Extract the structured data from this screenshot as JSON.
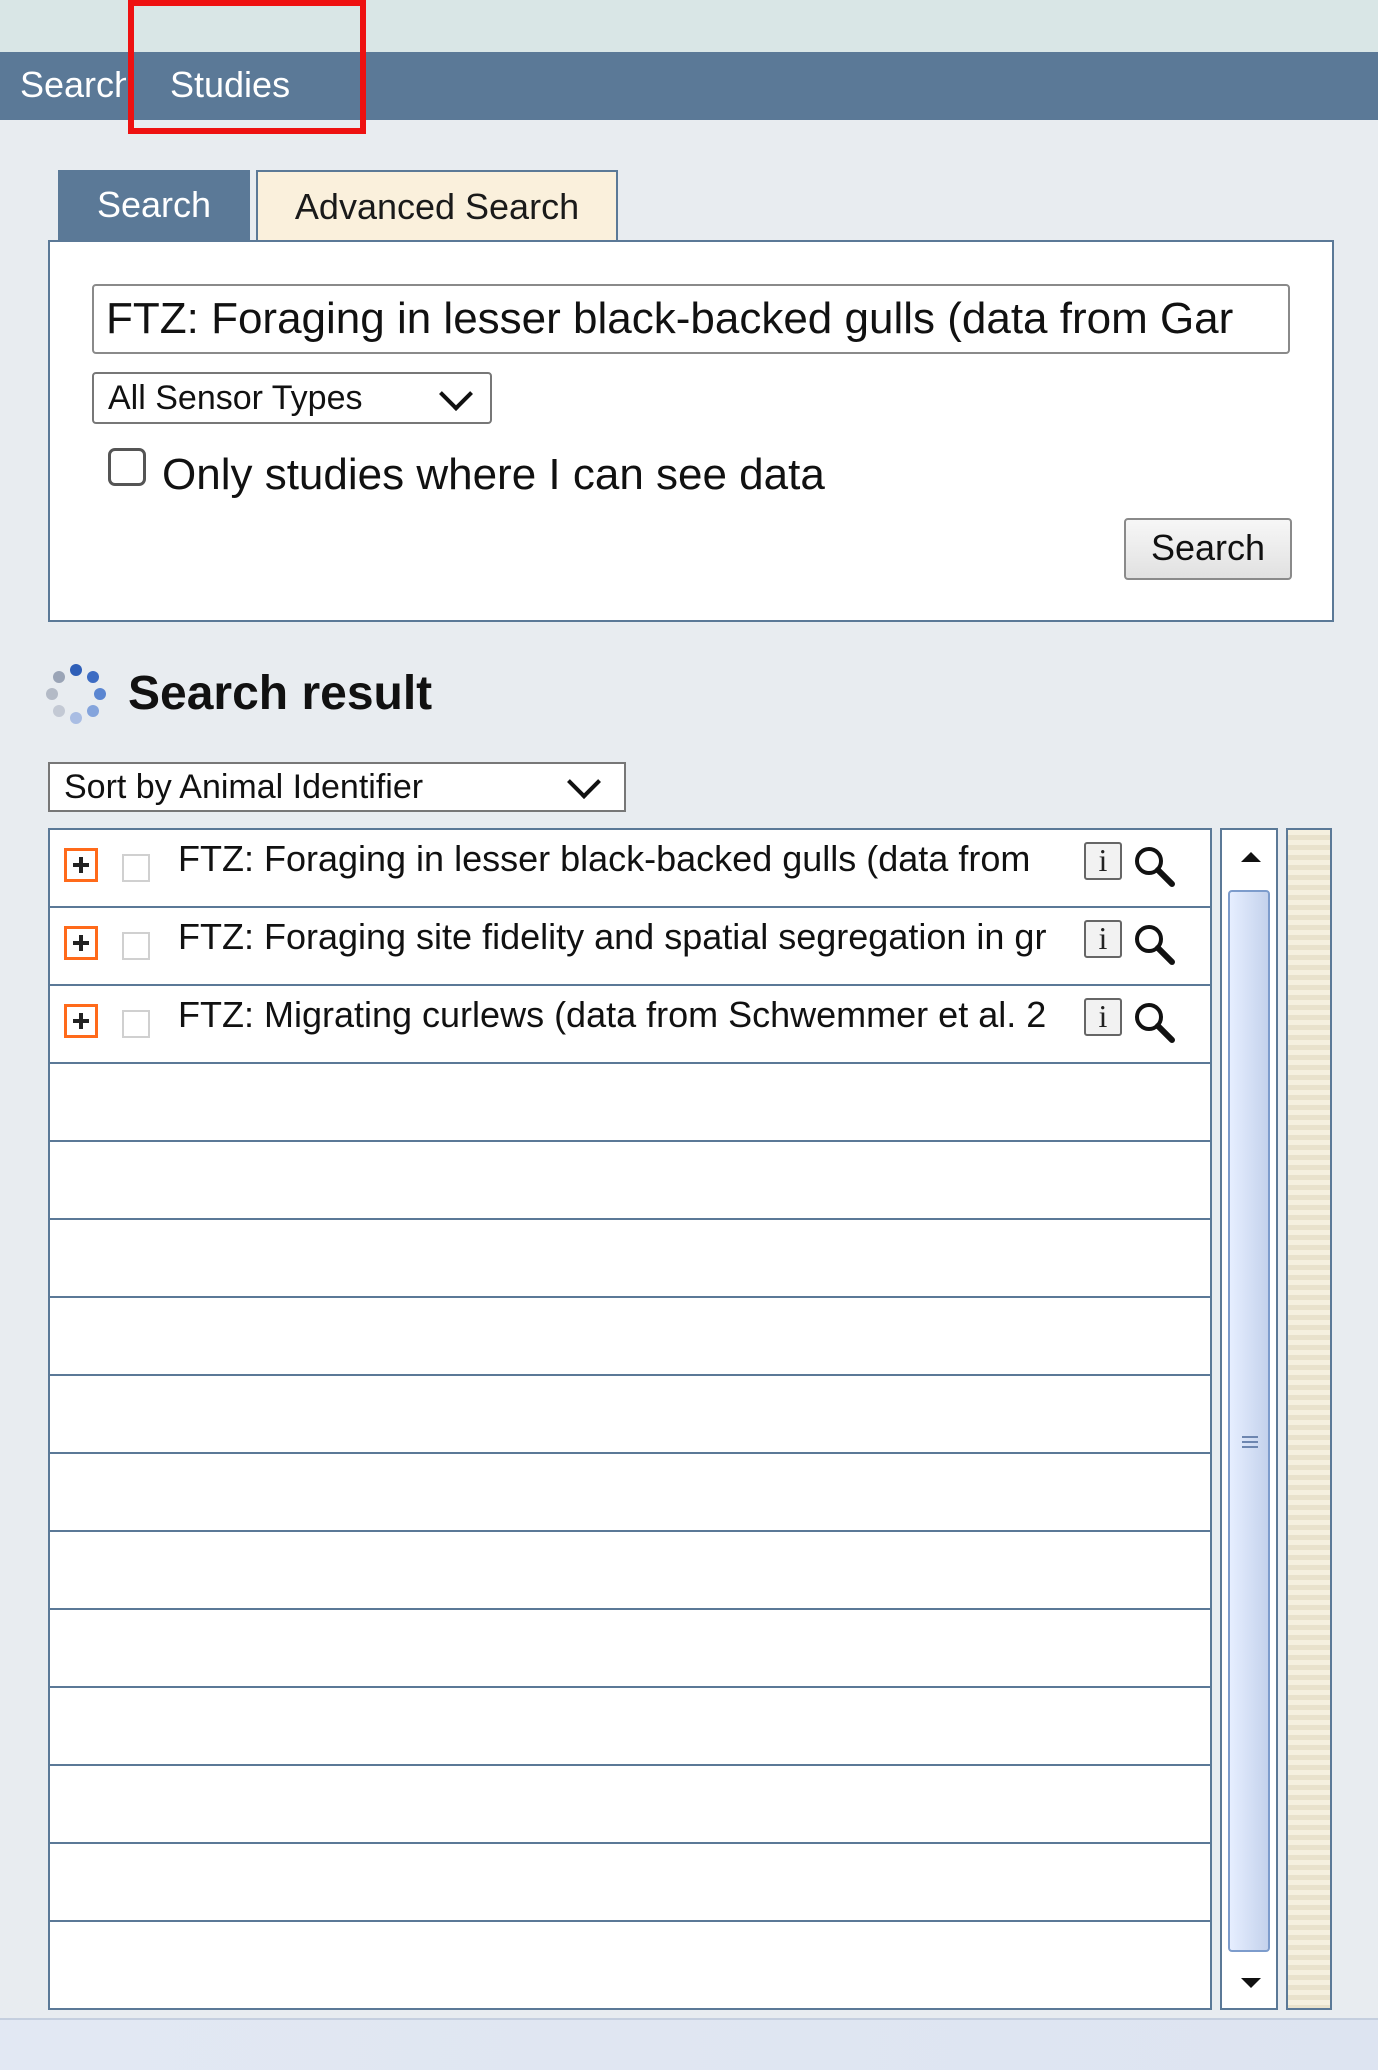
{
  "menu": {
    "items": [
      {
        "label": "Search"
      },
      {
        "label": "Studies"
      }
    ]
  },
  "tabs": {
    "search_label": "Search",
    "advanced_label": "Advanced Search",
    "active": "Search"
  },
  "search_form": {
    "query_value": "FTZ: Foraging in lesser black-backed gulls (data from Gar",
    "sensor_type": "All Sensor Types",
    "only_visible_label": "Only studies where I can see data",
    "only_visible_checked": false,
    "submit_label": "Search"
  },
  "results": {
    "title": "Search result",
    "sort_by": "Sort by Animal Identifier",
    "rows": [
      {
        "title": "FTZ: Foraging in lesser black-backed gulls (data from"
      },
      {
        "title": "FTZ: Foraging site fidelity and spatial segregation in gr"
      },
      {
        "title": "FTZ: Migrating curlews (data from Schwemmer et al. 2"
      }
    ],
    "empty_row_count": 12
  },
  "icons": {
    "expand": "expand-plus-icon",
    "info": "info-icon",
    "magnifier": "magnifier-icon",
    "loading": "loading-spinner-icon",
    "dropdown": "chevron-down-icon"
  },
  "colors": {
    "menubar": "#5b7997",
    "highlight": "#ee1111",
    "expand_border": "#ff6a1a",
    "advanced_tab": "#faf0dc"
  }
}
